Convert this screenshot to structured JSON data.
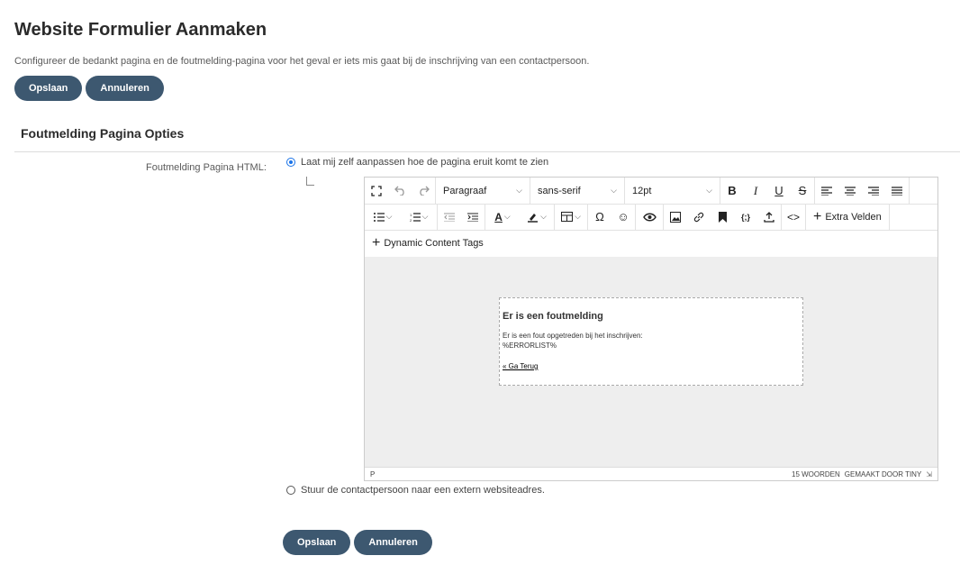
{
  "header": {
    "title": "Website Formulier Aanmaken",
    "description": "Configureer de bedankt pagina en de foutmelding-pagina voor het geval er iets mis gaat bij de inschrijving van een contactpersoon."
  },
  "top_actions": {
    "save_label": "Opslaan",
    "cancel_label": "Annuleren"
  },
  "section": {
    "title": "Foutmelding Pagina Opties"
  },
  "field": {
    "label": "Foutmelding Pagina HTML:",
    "option_custom": "Laat mij zelf aanpassen hoe de pagina eruit komt te zien",
    "option_external": "Stuur de contactpersoon naar een extern websiteadres."
  },
  "editor": {
    "toolbar": {
      "block_format": "Paragraaf",
      "font_family": "sans-serif",
      "font_size": "12pt",
      "extra_fields_label": "Extra Velden",
      "dynamic_tags_label": "Dynamic Content Tags"
    },
    "content": {
      "heading": "Er is een foutmelding",
      "line1": "Er is een fout opgetreden bij het inschrijven:",
      "line2": "%ERRORLIST%",
      "back_link": "« Ga Terug"
    },
    "status": {
      "path": "P",
      "word_count": "15 WOORDEN",
      "branding": "GEMAAKT DOOR TINY"
    }
  },
  "bottom_actions": {
    "save_label": "Opslaan",
    "cancel_label": "Annuleren"
  }
}
